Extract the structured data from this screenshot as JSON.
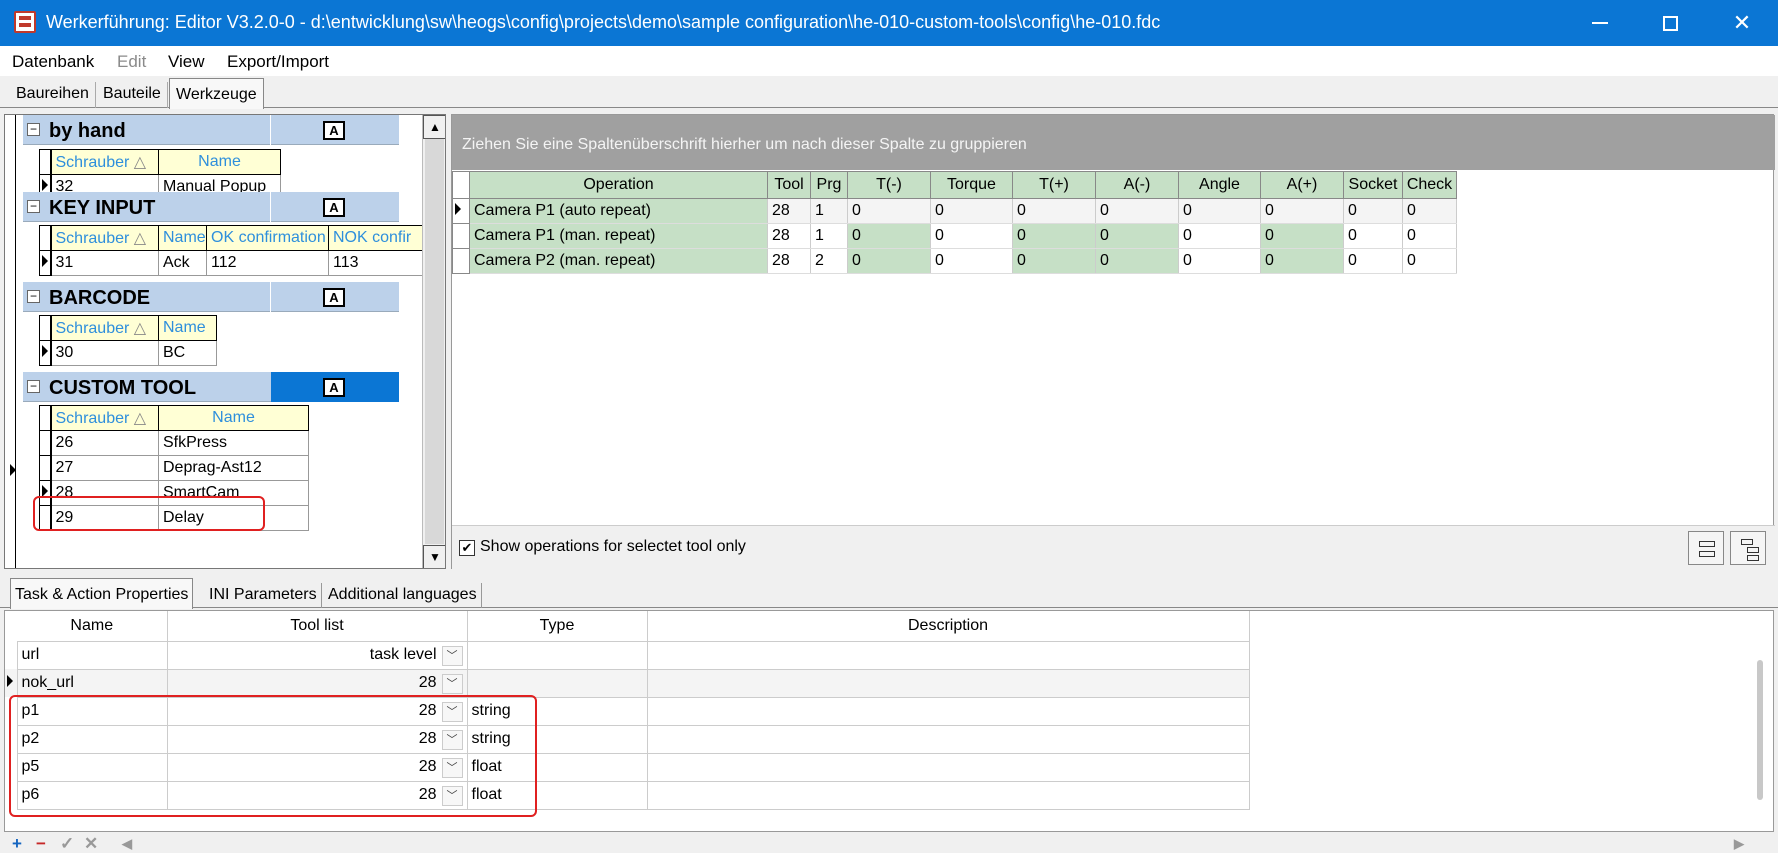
{
  "window": {
    "title": "Werkerführung: Editor V3.2.0-0 - d:\\entwicklung\\sw\\heogs\\config\\projects\\demo\\sample configuration\\he-010-custom-tools\\config\\he-010.fdc"
  },
  "menu": [
    "Datenbank",
    "Edit",
    "View",
    "Export/Import"
  ],
  "top_tabs": [
    "Baureihen",
    "Bauteile",
    "Werkzeuge"
  ],
  "tree": {
    "groups": [
      {
        "name": "by hand",
        "columns": [
          "Schrauber",
          "Name"
        ],
        "rows": [
          [
            "32",
            "Manual Popup"
          ]
        ]
      },
      {
        "name": "KEY INPUT",
        "columns": [
          "Schrauber",
          "Name",
          "OK confirmation",
          "NOK confir"
        ],
        "rows": [
          [
            "31",
            "Ack",
            "112",
            "113"
          ]
        ]
      },
      {
        "name": "BARCODE",
        "columns": [
          "Schrauber",
          "Name"
        ],
        "rows": [
          [
            "30",
            "BC"
          ]
        ]
      },
      {
        "name": "CUSTOM TOOL",
        "columns": [
          "Schrauber",
          "Name"
        ],
        "rows": [
          [
            "26",
            "SfkPress"
          ],
          [
            "27",
            "Deprag-Ast12"
          ],
          [
            "28",
            "SmartCam"
          ],
          [
            "29",
            "Delay"
          ]
        ]
      }
    ],
    "sort_glyph": "△",
    "a_glyph": "A"
  },
  "operations": {
    "group_hint": "Ziehen Sie eine Spaltenüberschrift hierher um nach dieser Spalte zu gruppieren",
    "columns": [
      "Operation",
      "Tool",
      "Prg",
      "T(-)",
      "Torque",
      "T(+)",
      "A(-)",
      "Angle",
      "A(+)",
      "Socket",
      "Check"
    ],
    "rows": [
      [
        "Camera P1 (auto repeat)",
        "28",
        "1",
        "0",
        "0",
        "0",
        "0",
        "0",
        "0",
        "0",
        "0"
      ],
      [
        "Camera P1 (man. repeat)",
        "28",
        "1",
        "0",
        "0",
        "0",
        "0",
        "0",
        "0",
        "0",
        "0"
      ],
      [
        "Camera P2 (man. repeat)",
        "28",
        "2",
        "0",
        "0",
        "0",
        "0",
        "0",
        "0",
        "0",
        "0"
      ]
    ],
    "show_selected_label": "Show operations for selectet tool only",
    "show_selected_checked": true
  },
  "bottom_tabs": [
    "Task & Action Properties",
    "INI Parameters",
    "Additional languages"
  ],
  "properties": {
    "columns": [
      "Name",
      "Tool list",
      "Type",
      "Description"
    ],
    "rows": [
      {
        "name": "url",
        "tool": "task level",
        "type": "",
        "desc": ""
      },
      {
        "name": "nok_url",
        "tool": "28",
        "type": "",
        "desc": ""
      },
      {
        "name": "p1",
        "tool": "28",
        "type": "string",
        "desc": ""
      },
      {
        "name": "p2",
        "tool": "28",
        "type": "string",
        "desc": ""
      },
      {
        "name": "p5",
        "tool": "28",
        "type": "float",
        "desc": ""
      },
      {
        "name": "p6",
        "tool": "28",
        "type": "float",
        "desc": ""
      }
    ]
  },
  "colors": {
    "titlebar": "#0b76d4",
    "header_green": "#c6e0c6",
    "highlight_red": "#e02020",
    "group_blue": "#bcd1ea"
  }
}
